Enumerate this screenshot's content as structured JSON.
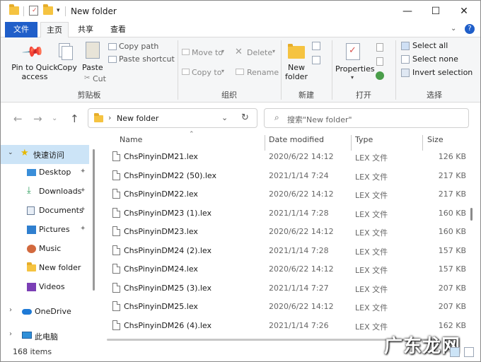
{
  "window": {
    "title": "New folder"
  },
  "tabs": {
    "file": "文件",
    "home": "主页",
    "share": "共享",
    "view": "查看"
  },
  "ribbon": {
    "pin_line1": "Pin to Quick",
    "pin_line2": "access",
    "copy": "Copy",
    "paste": "Paste",
    "cut": "Cut",
    "copy_path": "Copy path",
    "paste_shortcut": "Paste shortcut",
    "clipboard_group": "剪贴板",
    "move_to": "Move to",
    "copy_to": "Copy to",
    "delete": "Delete",
    "rename": "Rename",
    "organize_group": "组织",
    "new_folder_line1": "New",
    "new_folder_line2": "folder",
    "new_group": "新建",
    "properties": "Properties",
    "open_group": "打开",
    "select_all": "Select all",
    "select_none": "Select none",
    "invert_selection": "Invert selection",
    "select_group": "选择"
  },
  "address": {
    "path": "New folder",
    "search_placeholder": "搜索\"New folder\""
  },
  "nav": {
    "quick_access": "快速访问",
    "items": [
      "Desktop",
      "Downloads",
      "Documents",
      "Pictures",
      "Music",
      "New folder",
      "Videos"
    ],
    "onedrive": "OneDrive",
    "this_pc": "此电脑"
  },
  "columns": {
    "name": "Name",
    "date": "Date modified",
    "type": "Type",
    "size": "Size"
  },
  "files": [
    {
      "name": "ChsPinyinDM21.lex",
      "date": "2020/6/22 14:12",
      "type": "LEX 文件",
      "size": "126 KB"
    },
    {
      "name": "ChsPinyinDM22 (50).lex",
      "date": "2021/1/14 7:24",
      "type": "LEX 文件",
      "size": "217 KB"
    },
    {
      "name": "ChsPinyinDM22.lex",
      "date": "2020/6/22 14:12",
      "type": "LEX 文件",
      "size": "217 KB"
    },
    {
      "name": "ChsPinyinDM23 (1).lex",
      "date": "2021/1/14 7:28",
      "type": "LEX 文件",
      "size": "160 KB"
    },
    {
      "name": "ChsPinyinDM23.lex",
      "date": "2020/6/22 14:12",
      "type": "LEX 文件",
      "size": "160 KB"
    },
    {
      "name": "ChsPinyinDM24 (2).lex",
      "date": "2021/1/14 7:28",
      "type": "LEX 文件",
      "size": "157 KB"
    },
    {
      "name": "ChsPinyinDM24.lex",
      "date": "2020/6/22 14:12",
      "type": "LEX 文件",
      "size": "157 KB"
    },
    {
      "name": "ChsPinyinDM25 (3).lex",
      "date": "2021/1/14 7:27",
      "type": "LEX 文件",
      "size": "207 KB"
    },
    {
      "name": "ChsPinyinDM25.lex",
      "date": "2020/6/22 14:12",
      "type": "LEX 文件",
      "size": "207 KB"
    },
    {
      "name": "ChsPinyinDM26 (4).lex",
      "date": "2021/1/14 7:26",
      "type": "LEX 文件",
      "size": "162 KB"
    }
  ],
  "status": {
    "count": "168 items"
  },
  "watermark": "广东龙网",
  "colors": {
    "accent": "#1f5ec9",
    "selection": "#cce4f7",
    "folder": "#f5c341"
  }
}
